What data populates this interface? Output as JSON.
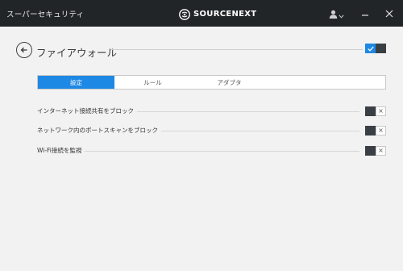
{
  "app": {
    "title": "スーパーセキュリティ",
    "brand": "SOURCENEXT"
  },
  "header": {
    "title": "ファイアウォール",
    "master_toggle_on": true
  },
  "tabs": [
    {
      "label": "設定",
      "active": true
    },
    {
      "label": "ルール",
      "active": false
    },
    {
      "label": "アダプタ",
      "active": false
    }
  ],
  "settings": [
    {
      "label": "インターネット接続共有をブロック",
      "enabled": false,
      "off_mark": "×"
    },
    {
      "label": "ネットワーク内のポートスキャンをブロック",
      "enabled": false,
      "off_mark": "×"
    },
    {
      "label": "Wi-Fi接続を監視",
      "enabled": false,
      "off_mark": "×"
    }
  ],
  "icons": {
    "back": "arrow-left-icon",
    "user": "user-icon",
    "minimize": "minimize-icon",
    "close": "close-icon",
    "check": "check-icon"
  },
  "colors": {
    "titlebar": "#222528",
    "accent": "#1e88e5",
    "toggle_knob": "#3a3f45",
    "background": "#f2f2f2"
  }
}
